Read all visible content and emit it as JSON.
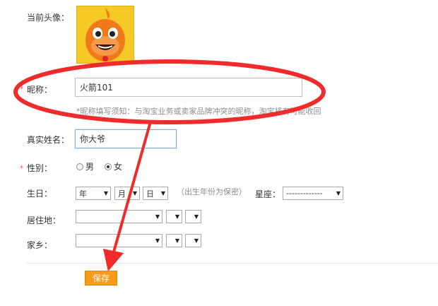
{
  "avatar": {
    "label": "当前头像："
  },
  "nickname": {
    "label": "昵称：",
    "value": "火箭101",
    "hint": "*昵称填写须知：与淘宝业务或卖家品牌冲突的昵称，淘宝将有可能收回"
  },
  "real_name": {
    "label": "真实姓名：",
    "value": "你大爷"
  },
  "gender": {
    "label": "性别：",
    "options": [
      {
        "label": "男",
        "checked": false
      },
      {
        "label": "女",
        "checked": true
      }
    ]
  },
  "birthday": {
    "label": "生日：",
    "year": "年",
    "month": "月",
    "day": "日",
    "privacy_note": "（出生年份为保密）",
    "constellation_label": "星座：",
    "constellation_value": "-------------"
  },
  "residence": {
    "label": "居住地："
  },
  "hometown": {
    "label": "家乡："
  },
  "required_mark": "*",
  "save_button": "保存",
  "colors": {
    "annotation_red": "#ef2b2b",
    "save_orange": "#f79b1b",
    "avatar_yellow": "#f6c927"
  }
}
